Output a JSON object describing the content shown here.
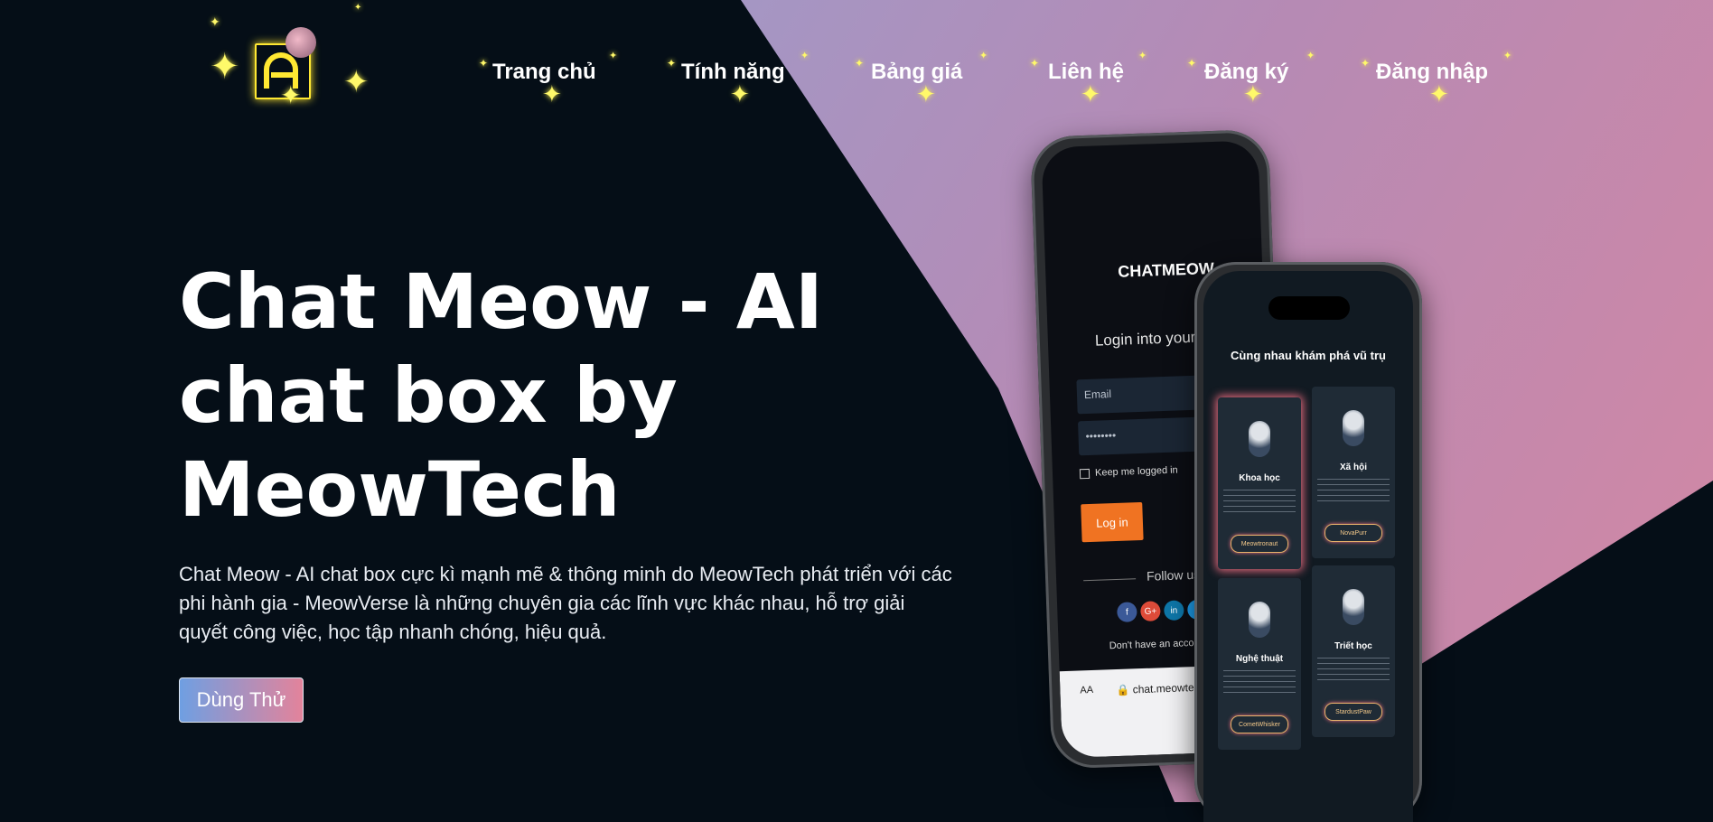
{
  "nav": {
    "items": [
      "Trang chủ",
      "Tính năng",
      "Bảng giá",
      "Liên hệ",
      "Đăng ký",
      "Đăng nhập"
    ]
  },
  "hero": {
    "title": "Chat Meow - AI chat box by MeowTech",
    "description": "Chat Meow - AI chat box cực kì mạnh mẽ & thông minh do MeowTech phát triển với các phi hành gia - MeowVerse là những chuyên gia các lĩnh vực khác nhau, hỗ trợ giải quyết công việc, học tập nhanh chóng, hiệu quả.",
    "cta_label": "Dùng Thử"
  },
  "phone_back": {
    "logo_text": "CHATMEOW",
    "title": "Login into your acc",
    "email_placeholder": "Email",
    "password_value": "••••••••",
    "keep_logged_in": "Keep me logged in",
    "login_button": "Log in",
    "follow_us": "Follow us",
    "social": [
      "f",
      "G+",
      "in",
      "t"
    ],
    "no_account": "Don't have an account? Re",
    "aa_label": "AA",
    "url": "🔒 chat.meowtech.v"
  },
  "phone_front": {
    "title": "Cùng nhau khám phá vũ trụ",
    "cards": [
      {
        "name": "Khoa học",
        "button": "Meowtronaut"
      },
      {
        "name": "Xã hội",
        "button": "NovaPurr"
      },
      {
        "name": "Nghệ thuật",
        "button": "CometWhisker"
      },
      {
        "name": "Triết học",
        "button": "StardustPaw"
      }
    ]
  },
  "colors": {
    "background": "#050e17",
    "accent_yellow": "#ffe832",
    "cta_gradient_start": "#6f9fe2",
    "cta_gradient_end": "#e3839b",
    "login_orange": "#f07322"
  },
  "icons": [
    "sparkle-icon",
    "logo-icon",
    "astronaut-icon"
  ]
}
